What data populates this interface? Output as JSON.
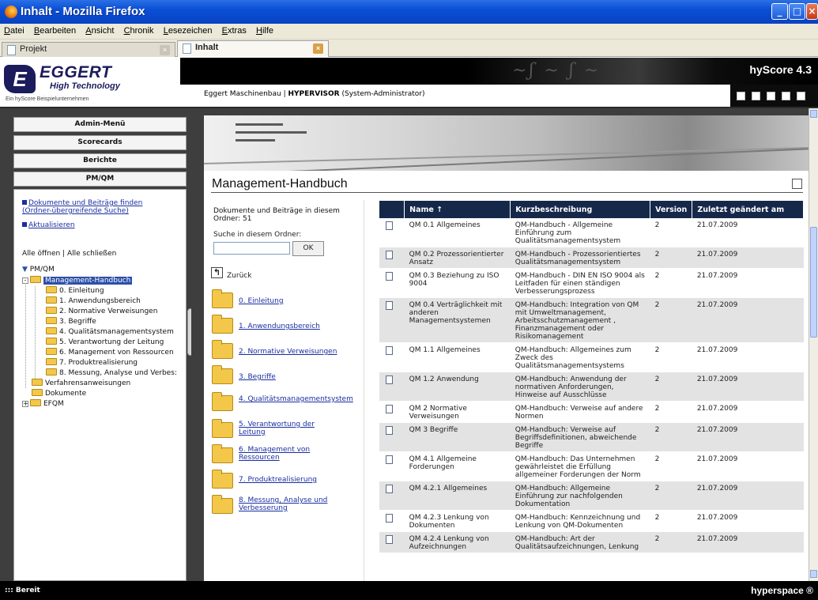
{
  "window": {
    "title": "Inhalt - Mozilla Firefox"
  },
  "menu": [
    "Datei",
    "Bearbeiten",
    "Ansicht",
    "Chronik",
    "Lesezeichen",
    "Extras",
    "Hilfe"
  ],
  "tabs": [
    {
      "label": "Projekt",
      "active": false
    },
    {
      "label": "Inhalt",
      "active": true
    }
  ],
  "header": {
    "logo_mark": "E",
    "logo_name": "EGGERT",
    "logo_sub": "High Technology",
    "logo_tag": "Ein hyScore Beispielunternehmen",
    "product": "hyScore 4.3",
    "user_company": "Eggert Maschinenbau | ",
    "user_name": "HYPERVISOR",
    "user_role": "  (System-Administrator)"
  },
  "nav": {
    "buttons": [
      "Admin-Menü",
      "Scorecards",
      "Berichte",
      "PM/QM"
    ],
    "link_find": "Dokumente und Beiträge finden (Ordner-übergreifende Suche)",
    "link_refresh": "Aktualisieren",
    "open_close": "Alle öffnen | Alle schließen",
    "tree_root": "PM/QM",
    "tree_selected": "Management-Handbuch",
    "tree_children": [
      "0. Einleitung",
      "1. Anwendungsbereich",
      "2. Normative Verweisungen",
      "3. Begriffe",
      "4. Qualitätsmanagementsystem",
      "5. Verantwortung der Leitung",
      "6. Management von Ressourcen",
      "7. Produktrealisierung",
      "8. Messung, Analyse und Verbes:"
    ],
    "tree_siblings": [
      "Verfahrensanweisungen",
      "Dokumente",
      "EFQM"
    ]
  },
  "main": {
    "title": "Management-Handbuch",
    "folder_info": "Dokumente und Beiträge in diesem Ordner: 51",
    "search_label": "Suche in diesem Ordner:",
    "search_value": "",
    "ok_label": "OK",
    "back_label": "Zurück",
    "folders": [
      "0. Einleitung",
      "1. Anwendungsbereich",
      "2. Normative Verweisungen",
      "3. Begriffe",
      "4. Qualitätsmanagementsystem",
      "5. Verantwortung der Leitung",
      "6. Management von Ressourcen",
      "7. Produktrealisierung",
      "8. Messung, Analyse und Verbesserung"
    ]
  },
  "table": {
    "headers": [
      "Name ↑",
      "Kurzbeschreibung",
      "Version",
      "Zuletzt geändert am"
    ],
    "rows": [
      [
        "QM 0.1 Allgemeines",
        "QM-Handbuch - Allgemeine Einführung zum Qualitätsmanagementsystem",
        "2",
        "21.07.2009"
      ],
      [
        "QM 0.2 Prozessorientierter Ansatz",
        "QM-Handbuch - Prozessorientiertes Qualitätsmanagementsystem",
        "2",
        "21.07.2009"
      ],
      [
        "QM 0.3 Beziehung zu ISO 9004",
        "QM-Handbuch - DIN EN ISO 9004 als Leitfaden für einen ständigen Verbesserungsprozess",
        "2",
        "21.07.2009"
      ],
      [
        "QM 0.4 Verträglichkeit mit anderen Managementsystemen",
        "QM-Handbuch: Integration von QM mit Umweltmanagement, Arbeitsschutzmanagement , Finanzmanagement oder Risikomanagement",
        "2",
        "21.07.2009"
      ],
      [
        "QM 1.1 Allgemeines",
        "QM-Handbuch: Allgemeines zum Zweck des Qualitätsmanagementsystems",
        "2",
        "21.07.2009"
      ],
      [
        "QM 1.2 Anwendung",
        "QM-Handbuch: Anwendung der normativen Anforderungen, Hinweise auf Ausschlüsse",
        "2",
        "21.07.2009"
      ],
      [
        "QM 2 Normative Verweisungen",
        "QM-Handbuch: Verweise auf andere Normen",
        "2",
        "21.07.2009"
      ],
      [
        "QM 3 Begriffe",
        "QM-Handbuch: Verweise auf Begriffsdefinitionen, abweichende Begriffe",
        "2",
        "21.07.2009"
      ],
      [
        "QM 4.1 Allgemeine Forderungen",
        "QM-Handbuch: Das Unternehmen gewährleistet die Erfüllung allgemeiner Forderungen der Norm",
        "2",
        "21.07.2009"
      ],
      [
        "QM 4.2.1 Allgemeines",
        "QM-Handbuch: Allgemeine Einführung zur nachfolgenden Dokumentation",
        "2",
        "21.07.2009"
      ],
      [
        "QM 4.2.3 Lenkung von Dokumenten",
        "QM-Handbuch: Kennzeichnung und Lenkung von QM-Dokumenten",
        "2",
        "21.07.2009"
      ],
      [
        "QM 4.2.4 Lenkung von Aufzeichnungen",
        "QM-Handbuch: Art der Qualitätsaufzeichnungen, Lenkung",
        "2",
        "21.07.2009"
      ]
    ]
  },
  "status": {
    "text": "::: Bereit",
    "brand": "hyperspace ®"
  },
  "colors": {
    "titlebar": "#0a4fd6",
    "table_header": "#16284a",
    "link": "#1a2fa0",
    "tree_selected": "#2c4fa8"
  }
}
